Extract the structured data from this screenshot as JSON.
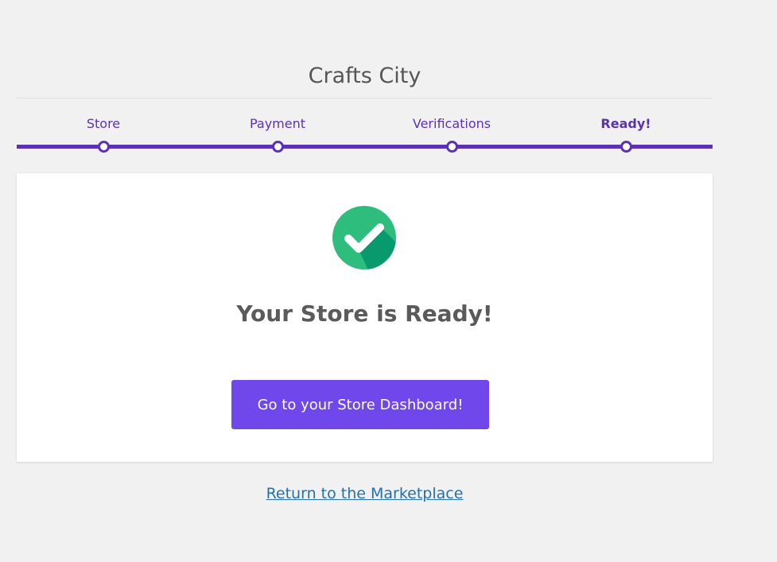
{
  "header": {
    "site_title": "Crafts City"
  },
  "steps": [
    {
      "label": "Store",
      "active": false
    },
    {
      "label": "Payment",
      "active": false
    },
    {
      "label": "Verifications",
      "active": false
    },
    {
      "label": "Ready!",
      "active": true
    }
  ],
  "card": {
    "heading": "Your Store is Ready!",
    "button_label": "Go to your Store Dashboard!"
  },
  "footer": {
    "return_link": "Return to the Marketplace"
  },
  "colors": {
    "accent": "#5b32b4",
    "button": "#7047eb",
    "success": "#2fbd7e",
    "link": "#2271b1"
  },
  "icons": {
    "success": "check-circle-icon"
  }
}
